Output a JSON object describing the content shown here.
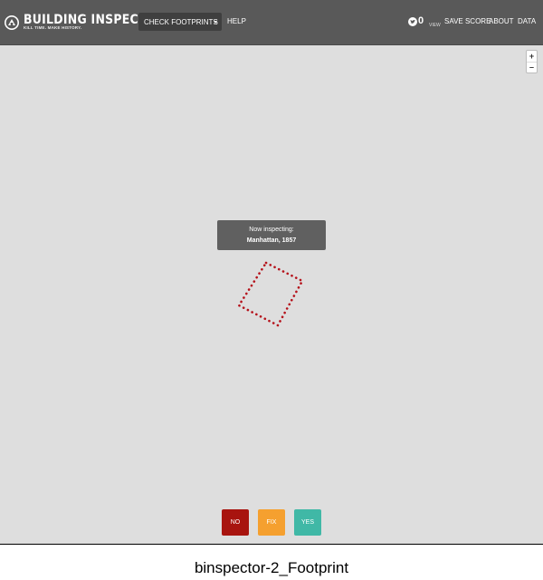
{
  "app": {
    "title": "BUILDING INSPECTOR",
    "tagline": "KILL TIME. MAKE HISTORY."
  },
  "nav": {
    "dropdown_label": "CHECK FOOTPRINTS",
    "help_label": "HELP",
    "score_value": "0",
    "score_view_label": "VIEW",
    "save_score_label": "SAVE SCORE",
    "about_label": "ABOUT",
    "data_label": "DATA"
  },
  "map": {
    "zoom_in": "+",
    "zoom_out": "–",
    "popup_line1": "Now inspecting:",
    "popup_line2": "Manhattan, 1857",
    "footprint_color": "#b5121b"
  },
  "actions": {
    "no_label": "NO",
    "fix_label": "FIX",
    "yes_label": "YES",
    "no_color": "#a8140f",
    "fix_color": "#f5a02f",
    "yes_color": "#40b8a6"
  },
  "caption": "binspector-2_Footprint",
  "icons": [
    "building-inspector-logo-icon",
    "caret-down-icon",
    "twitter-icon"
  ]
}
